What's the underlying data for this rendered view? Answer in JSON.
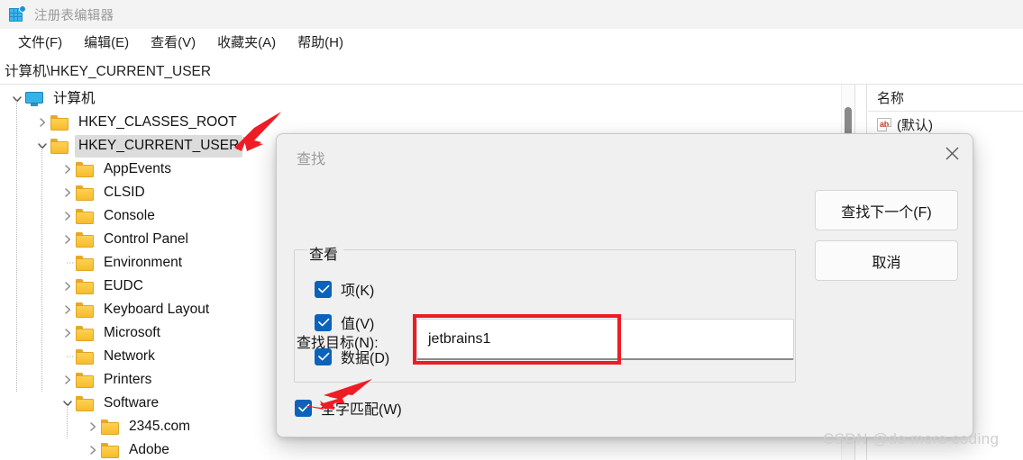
{
  "window": {
    "title": "注册表编辑器",
    "icon": "registry-editor-icon"
  },
  "menubar": {
    "items": [
      {
        "label": "文件(F)"
      },
      {
        "label": "编辑(E)"
      },
      {
        "label": "查看(V)"
      },
      {
        "label": "收藏夹(A)"
      },
      {
        "label": "帮助(H)"
      }
    ]
  },
  "address": {
    "path": "计算机\\HKEY_CURRENT_USER"
  },
  "tree": {
    "nodes": [
      {
        "label": "计算机",
        "depth": 0,
        "expanded": true,
        "hasChildren": true,
        "icon": "monitor-icon",
        "selected": false
      },
      {
        "label": "HKEY_CLASSES_ROOT",
        "depth": 1,
        "expanded": false,
        "hasChildren": true,
        "icon": "folder-icon",
        "selected": false
      },
      {
        "label": "HKEY_CURRENT_USER",
        "depth": 1,
        "expanded": true,
        "hasChildren": true,
        "icon": "folder-icon",
        "selected": true
      },
      {
        "label": "AppEvents",
        "depth": 2,
        "expanded": false,
        "hasChildren": true,
        "icon": "folder-icon",
        "selected": false
      },
      {
        "label": "CLSID",
        "depth": 2,
        "expanded": false,
        "hasChildren": true,
        "icon": "folder-icon",
        "selected": false
      },
      {
        "label": "Console",
        "depth": 2,
        "expanded": false,
        "hasChildren": true,
        "icon": "folder-icon",
        "selected": false
      },
      {
        "label": "Control Panel",
        "depth": 2,
        "expanded": false,
        "hasChildren": true,
        "icon": "folder-icon",
        "selected": false
      },
      {
        "label": "Environment",
        "depth": 2,
        "expanded": false,
        "hasChildren": false,
        "icon": "folder-icon",
        "selected": false
      },
      {
        "label": "EUDC",
        "depth": 2,
        "expanded": false,
        "hasChildren": true,
        "icon": "folder-icon",
        "selected": false
      },
      {
        "label": "Keyboard Layout",
        "depth": 2,
        "expanded": false,
        "hasChildren": true,
        "icon": "folder-icon",
        "selected": false
      },
      {
        "label": "Microsoft",
        "depth": 2,
        "expanded": false,
        "hasChildren": true,
        "icon": "folder-icon",
        "selected": false
      },
      {
        "label": "Network",
        "depth": 2,
        "expanded": false,
        "hasChildren": false,
        "icon": "folder-icon",
        "selected": false
      },
      {
        "label": "Printers",
        "depth": 2,
        "expanded": false,
        "hasChildren": true,
        "icon": "folder-icon",
        "selected": false
      },
      {
        "label": "Software",
        "depth": 2,
        "expanded": true,
        "hasChildren": true,
        "icon": "folder-icon",
        "selected": false
      },
      {
        "label": "2345.com",
        "depth": 3,
        "expanded": false,
        "hasChildren": true,
        "icon": "folder-icon",
        "selected": false
      },
      {
        "label": "Adobe",
        "depth": 3,
        "expanded": false,
        "hasChildren": true,
        "icon": "folder-icon",
        "selected": false
      }
    ]
  },
  "values_pane": {
    "column_header": "名称",
    "rows": [
      {
        "icon": "string-value-icon",
        "icon_text": "ab",
        "name": "(默认)"
      }
    ]
  },
  "find_dialog": {
    "title": "查找",
    "close_icon": "close-icon",
    "find_label": "查找目标(N):",
    "find_value": "jetbrains1",
    "find_placeholder": "",
    "group": {
      "title": "查看",
      "checkboxes": [
        {
          "label": "项(K)",
          "checked": true
        },
        {
          "label": "值(V)",
          "checked": true
        },
        {
          "label": "数据(D)",
          "checked": true
        }
      ]
    },
    "whole_word": {
      "label": "全字匹配(W)",
      "checked": true
    },
    "buttons": [
      {
        "label": "查找下一个(F)"
      },
      {
        "label": "取消"
      }
    ]
  },
  "annotations": {
    "highlight_color": "#ee1c24",
    "arrow_to_hkcu": "red-arrow-icon",
    "arrow_to_whole_word": "red-arrow-icon"
  },
  "watermark": {
    "text": "CSDN @do more coding"
  }
}
